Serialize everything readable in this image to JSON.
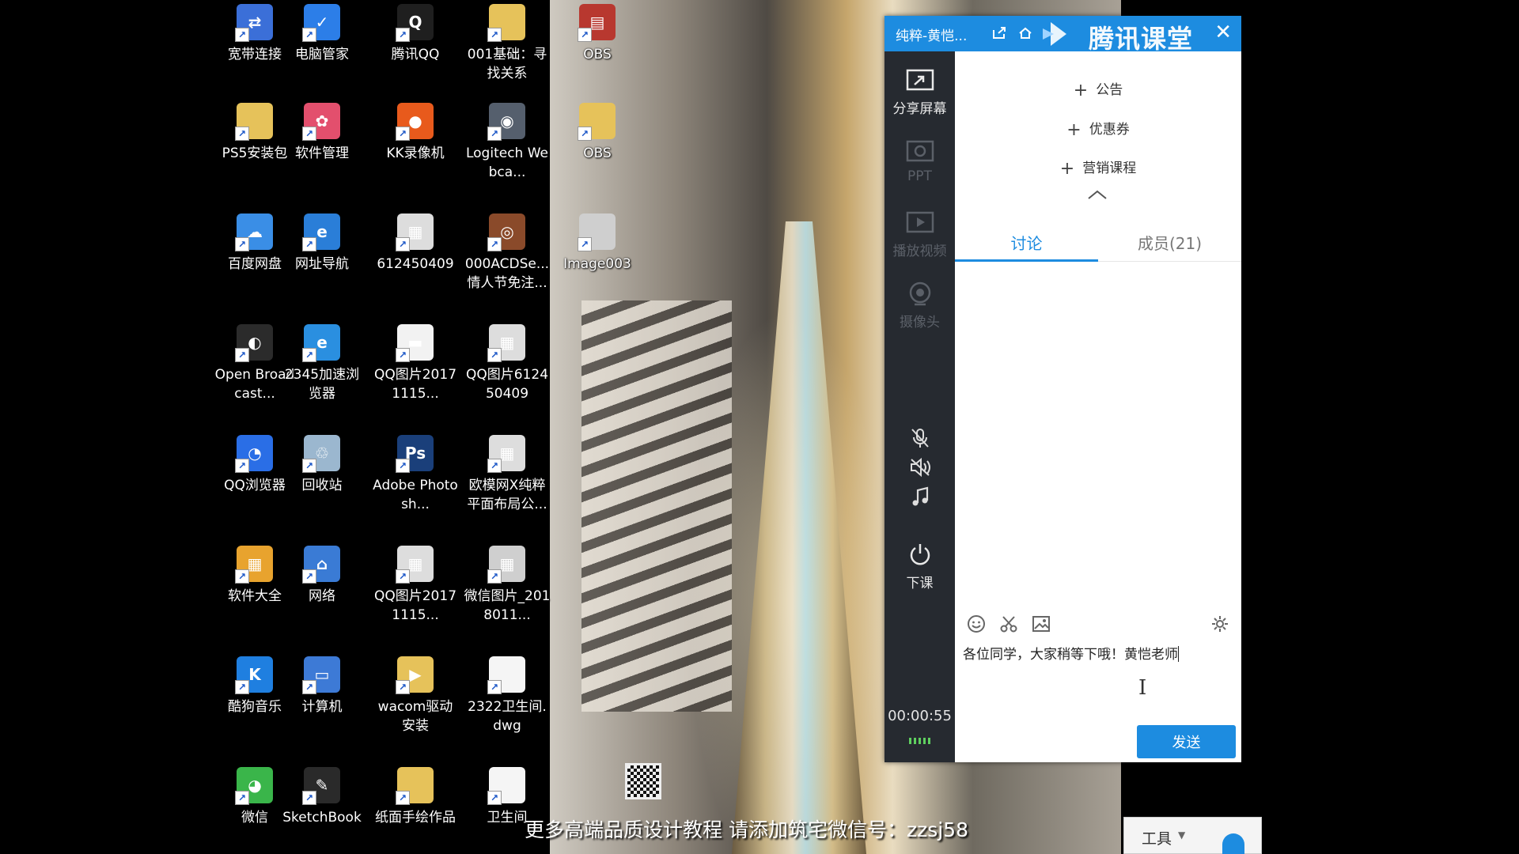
{
  "desktop": {
    "icons": [
      {
        "label": "宽带连接",
        "name": "broadband-connection",
        "color": "#3b6fd8",
        "glyph": "⇄"
      },
      {
        "label": "电脑管家",
        "name": "pc-manager",
        "color": "#2c7ee8",
        "glyph": "✓"
      },
      {
        "label": "腾讯QQ",
        "name": "tencent-qq",
        "color": "#1f1f1f",
        "glyph": "Q"
      },
      {
        "label": "001基础：寻找关系",
        "name": "folder-001",
        "color": "#e6c25a",
        "glyph": ""
      },
      {
        "label": "OBS",
        "name": "obs-zip",
        "color": "#b8382f",
        "glyph": "▤"
      },
      {
        "label": "PS5安装包",
        "name": "ps5-installer",
        "color": "#e6c25a",
        "glyph": ""
      },
      {
        "label": "软件管理",
        "name": "software-manager",
        "color": "#e34f6d",
        "glyph": "✿"
      },
      {
        "label": "KK录像机",
        "name": "kk-recorder",
        "color": "#e85a1c",
        "glyph": "●"
      },
      {
        "label": "Logitech Webca...",
        "name": "logitech-webcam",
        "color": "#555f6d",
        "glyph": "◉"
      },
      {
        "label": "OBS",
        "name": "obs-folder",
        "color": "#e6c25a",
        "glyph": ""
      },
      {
        "label": "百度网盘",
        "name": "baidu-netdisk",
        "color": "#3a8ee6",
        "glyph": "☁"
      },
      {
        "label": "网址导航",
        "name": "url-navigator",
        "color": "#2a7ed8",
        "glyph": "e"
      },
      {
        "label": "612450409",
        "name": "image-612450409",
        "color": "#dddddd",
        "glyph": "▦"
      },
      {
        "label": "000ACDSe...情人节免注...",
        "name": "acdsee",
        "color": "#8a4a2a",
        "glyph": "◎"
      },
      {
        "label": "Image003",
        "name": "image003",
        "color": "#cfcfcf",
        "glyph": ""
      },
      {
        "label": "Open Broadcast...",
        "name": "open-broadcaster",
        "color": "#2b2b2b",
        "glyph": "◐"
      },
      {
        "label": "2345加速浏览器",
        "name": "browser-2345",
        "color": "#2a8fe0",
        "glyph": "e"
      },
      {
        "label": "QQ图片20171115...",
        "name": "qq-image-1",
        "color": "#f2f2f2",
        "glyph": "▬"
      },
      {
        "label": "QQ图片612450409",
        "name": "qq-image-2",
        "color": "#dddddd",
        "glyph": "▦"
      },
      {
        "label": "QQ浏览器",
        "name": "qq-browser",
        "color": "#2a6ee6",
        "glyph": "◔"
      },
      {
        "label": "回收站",
        "name": "recycle-bin",
        "color": "#9bb7cf",
        "glyph": "♲"
      },
      {
        "label": "Adobe Photosh...",
        "name": "adobe-photoshop",
        "color": "#1a3f7a",
        "glyph": "Ps"
      },
      {
        "label": "欧模网X纯粹平面布局公...",
        "name": "omo-image",
        "color": "#dddddd",
        "glyph": "▦"
      },
      {
        "label": "软件大全",
        "name": "software-collection",
        "color": "#e8a32e",
        "glyph": "▦"
      },
      {
        "label": "网络",
        "name": "network",
        "color": "#3a7bd5",
        "glyph": "⌂"
      },
      {
        "label": "QQ图片20171115...",
        "name": "qq-image-3",
        "color": "#dddddd",
        "glyph": "▦"
      },
      {
        "label": "微信图片_2018011...",
        "name": "wechat-image",
        "color": "#cfcfcf",
        "glyph": "▦"
      },
      {
        "label": "酷狗音乐",
        "name": "kugou-music",
        "color": "#1f7fe0",
        "glyph": "K"
      },
      {
        "label": "计算机",
        "name": "computer",
        "color": "#3d7ad6",
        "glyph": "▭"
      },
      {
        "label": "wacom驱动安装",
        "name": "wacom-driver",
        "color": "#e6c25a",
        "glyph": "▶"
      },
      {
        "label": "2322卫生间.dwg",
        "name": "dwg-file-1",
        "color": "#f5f5f5",
        "glyph": ""
      },
      {
        "label": "微信",
        "name": "wechat",
        "color": "#3ab54a",
        "glyph": "◕"
      },
      {
        "label": "SketchBook",
        "name": "sketchbook",
        "color": "#2a2a2a",
        "glyph": "✎"
      },
      {
        "label": "纸面手绘作品",
        "name": "hand-drawn-folder",
        "color": "#e6c25a",
        "glyph": ""
      },
      {
        "label": "卫生间",
        "name": "dwg-file-2",
        "color": "#f5f5f5",
        "glyph": ""
      }
    ]
  },
  "classroom": {
    "title": "纯粹-黄恺...",
    "brand": "腾讯课堂",
    "close_glyph": "✕",
    "sidebar": {
      "share_screen": "分享屏幕",
      "ppt": "PPT",
      "play_video": "播放视频",
      "camera": "摄像头",
      "end_class": "下课",
      "timer": "00:00:55"
    },
    "add_items": [
      "公告",
      "优惠券",
      "营销课程"
    ],
    "tabs": {
      "discussion": "讨论",
      "members": "成员(21)"
    },
    "input_text": "各位同学，大家稍等下哦！黄恺老师",
    "send": "发送",
    "accent": "#1d8ce0"
  },
  "caption": "更多高端品质设计教程  请添加筑宅微信号：zzsj58",
  "tools_panel": {
    "label": "工具",
    "caret": "▼"
  }
}
